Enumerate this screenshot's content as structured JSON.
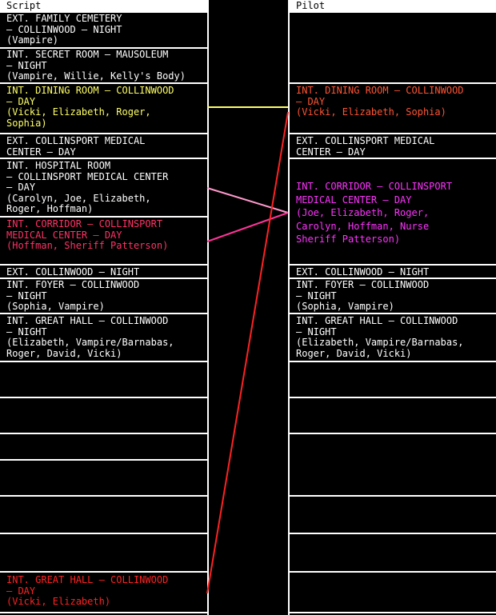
{
  "script": {
    "title": "Script",
    "scenes": [
      {
        "lines": [
          "EXT. FAMILY CEMETERY",
          "– COLLINWOOD – NIGHT",
          "(Vampire)"
        ],
        "color": "#ffffff"
      },
      {
        "lines": [
          "INT. SECRET ROOM – MAUSOLEUM",
          "– NIGHT",
          "(Vampire, Willie, Kelly's Body)"
        ],
        "color": "#ffffff"
      },
      {
        "lines": [
          "INT. DINING ROOM – COLLINWOOD",
          "– DAY",
          "(Vicki, Elizabeth, Roger,",
          "Sophia)"
        ],
        "color": "#ffff66"
      },
      {
        "lines": [
          "EXT. COLLINSPORT MEDICAL",
          "CENTER – DAY"
        ],
        "color": "#ffffff"
      },
      {
        "lines": [
          "INT. HOSPITAL ROOM",
          "– COLLINSPORT MEDICAL CENTER",
          "– DAY",
          "(Carolyn, Joe, Elizabeth,",
          "Roger, Hoffman)"
        ],
        "color": "#ffffff"
      },
      {
        "lines": [
          "INT. CORRIDOR – COLLINSPORT",
          "MEDICAL CENTER – DAY",
          "(Hoffman, Sheriff Patterson)"
        ],
        "color": "#ff3366"
      },
      {
        "lines": [
          "EXT. COLLINWOOD – NIGHT"
        ],
        "color": "#ffffff"
      },
      {
        "lines": [
          "INT. FOYER – COLLINWOOD",
          "– NIGHT",
          "(Sophia, Vampire)"
        ],
        "color": "#ffffff"
      },
      {
        "lines": [
          "INT. GREAT HALL – COLLINWOOD",
          "– NIGHT",
          "(Elizabeth, Vampire/Barnabas,",
          "Roger, David, Vicki)"
        ],
        "color": "#ffffff"
      },
      {
        "lines": [
          "INT. GREAT HALL – COLLINWOOD",
          "– DAY",
          "(Vicki, Elizabeth)"
        ],
        "color": "#ff2222"
      }
    ]
  },
  "pilot": {
    "title": "Pilot",
    "scenes": [
      {
        "lines": [
          "INT. DINING ROOM – COLLINWOOD",
          "– DAY",
          "(Vicki, Elizabeth, Sophia)"
        ],
        "color": "#ff5533"
      },
      {
        "lines": [
          "EXT. COLLINSPORT MEDICAL",
          "CENTER – DAY"
        ],
        "color": "#ffffff"
      },
      {
        "lines": [
          "INT. CORRIDOR – COLLINSPORT",
          "MEDICAL CENTER – DAY",
          "(Joe, Elizabeth, Roger,",
          "Carolyn, Hoffman, Nurse",
          "Sheriff Patterson)"
        ],
        "color": "#ff33ff"
      },
      {
        "lines": [
          "EXT. COLLINWOOD – NIGHT"
        ],
        "color": "#ffffff"
      },
      {
        "lines": [
          "INT. FOYER – COLLINWOOD",
          "– NIGHT",
          "(Sophia, Vampire)"
        ],
        "color": "#ffffff"
      },
      {
        "lines": [
          "INT. GREAT HALL – COLLINWOOD",
          "– NIGHT",
          "(Elizabeth, Vampire/Barnabas,",
          "Roger, David, Vicki)"
        ],
        "color": "#ffffff"
      }
    ]
  },
  "connectors": [
    {
      "from": "INT. DINING ROOM – COLLINWOOD – DAY (script)",
      "to": "INT. DINING ROOM – COLLINWOOD – DAY (pilot)",
      "color": "#ffff66"
    },
    {
      "from": "INT. HOSPITAL ROOM (script)",
      "to": "INT. CORRIDOR (pilot)",
      "color": "#ff99cc"
    },
    {
      "from": "INT. CORRIDOR (script)",
      "to": "INT. CORRIDOR (pilot)",
      "color": "#ff3399"
    },
    {
      "from": "INT. GREAT HALL – DAY (script)",
      "to": "INT. DINING ROOM (pilot)",
      "color": "#ff2222"
    }
  ]
}
